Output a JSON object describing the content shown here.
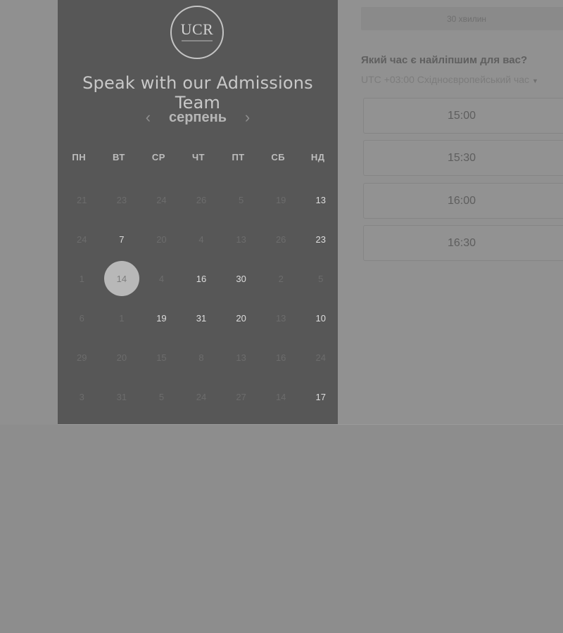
{
  "calendar": {
    "logo_text": "UCR",
    "title": "Speak with our Admissions Team",
    "month": "серпень",
    "prev_icon": "‹",
    "next_icon": "›",
    "weekdays": [
      "ПН",
      "ВТ",
      "СР",
      "ЧТ",
      "ПТ",
      "СБ",
      "НД"
    ],
    "weeks": [
      [
        {
          "d": "21",
          "a": false
        },
        {
          "d": "23",
          "a": false
        },
        {
          "d": "24",
          "a": false
        },
        {
          "d": "26",
          "a": false
        },
        {
          "d": "5",
          "a": false
        },
        {
          "d": "19",
          "a": false
        },
        {
          "d": "13",
          "a": true
        }
      ],
      [
        {
          "d": "24",
          "a": false
        },
        {
          "d": "7",
          "a": true
        },
        {
          "d": "20",
          "a": false
        },
        {
          "d": "4",
          "a": false
        },
        {
          "d": "13",
          "a": false
        },
        {
          "d": "26",
          "a": false
        },
        {
          "d": "23",
          "a": true
        }
      ],
      [
        {
          "d": "1",
          "a": false
        },
        {
          "d": "14",
          "a": false,
          "s": true
        },
        {
          "d": "4",
          "a": false
        },
        {
          "d": "16",
          "a": true
        },
        {
          "d": "30",
          "a": true
        },
        {
          "d": "2",
          "a": false
        },
        {
          "d": "5",
          "a": false
        }
      ],
      [
        {
          "d": "6",
          "a": false
        },
        {
          "d": "1",
          "a": false
        },
        {
          "d": "19",
          "a": true
        },
        {
          "d": "31",
          "a": true
        },
        {
          "d": "20",
          "a": true
        },
        {
          "d": "13",
          "a": false
        },
        {
          "d": "10",
          "a": true
        }
      ],
      [
        {
          "d": "29",
          "a": false
        },
        {
          "d": "20",
          "a": false
        },
        {
          "d": "15",
          "a": false
        },
        {
          "d": "8",
          "a": false
        },
        {
          "d": "13",
          "a": false
        },
        {
          "d": "16",
          "a": false
        },
        {
          "d": "24",
          "a": false
        }
      ],
      [
        {
          "d": "3",
          "a": false
        },
        {
          "d": "31",
          "a": false
        },
        {
          "d": "5",
          "a": false
        },
        {
          "d": "24",
          "a": false
        },
        {
          "d": "27",
          "a": false
        },
        {
          "d": "14",
          "a": false
        },
        {
          "d": "17",
          "a": true
        }
      ]
    ]
  },
  "booking": {
    "duration": "30 хвилин",
    "question": "Який час є найліпшим для вас?",
    "timezone": "UTC +03:00 Східноєвропейський час",
    "timezone_caret": "▼",
    "slots": [
      "15:00",
      "15:30",
      "16:00",
      "16:30"
    ]
  },
  "colors": {
    "panel": "#575757",
    "overlay": "#919191",
    "selected_day": "#b8b8b8"
  }
}
